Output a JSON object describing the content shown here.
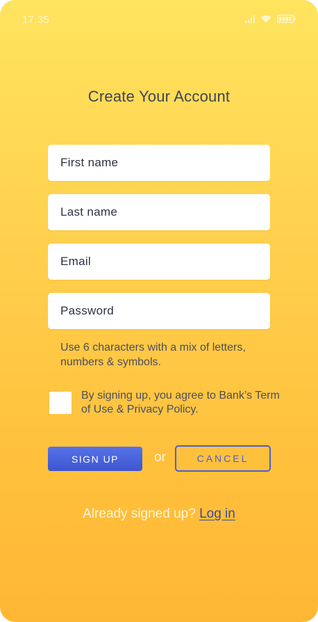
{
  "status_bar": {
    "time": "17.35",
    "icons": [
      "signal-icon",
      "wifi-icon",
      "battery-icon"
    ]
  },
  "title": "Create Your Account",
  "form": {
    "first_name": {
      "placeholder": "First name",
      "value": ""
    },
    "last_name": {
      "placeholder": "Last name",
      "value": ""
    },
    "email": {
      "placeholder": "Email",
      "value": ""
    },
    "password": {
      "placeholder": "Password",
      "value": ""
    }
  },
  "password_hint": "Use 6 characters with a mix of letters, numbers & symbols.",
  "terms": {
    "checked": false,
    "text": "By signing up, you agree to Bank’s Term of Use & Privacy Policy."
  },
  "actions": {
    "signup_label": "SIGN UP",
    "or_label": "or",
    "cancel_label": "CANCEL"
  },
  "login": {
    "prompt": "Already signed up?",
    "link_label": "Log in"
  },
  "colors": {
    "background_top": "#ffe45f",
    "background_bottom": "#ffb733",
    "primary": "#4d5fd0",
    "text_dark": "#3f4357"
  }
}
